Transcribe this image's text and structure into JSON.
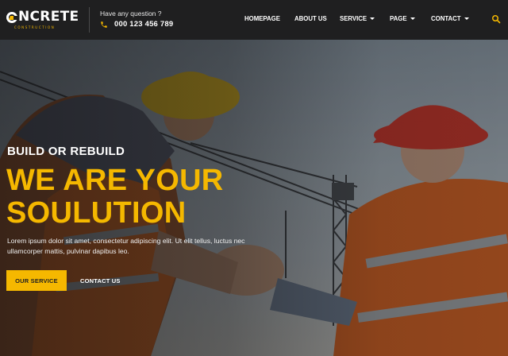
{
  "brand": {
    "logo_text": "NCRETE",
    "logo_sub": "CONSTRUCTION",
    "accent": "#f5b800"
  },
  "contact": {
    "question": "Have any question ?",
    "phone": "000 123 456 789",
    "icon": "phone-icon"
  },
  "nav": {
    "items": [
      {
        "label": "HOMEPAGE",
        "dropdown": false
      },
      {
        "label": "ABOUT US",
        "dropdown": false
      },
      {
        "label": "SERVICE",
        "dropdown": true
      },
      {
        "label": "PAGE",
        "dropdown": true
      },
      {
        "label": "CONTACT",
        "dropdown": true
      }
    ],
    "search_icon": "search-icon"
  },
  "hero": {
    "kicker": "BUILD OR REBUILD",
    "headline_line1": "WE ARE YOUR",
    "headline_line2": "SOULUTION",
    "description": "Lorem ipsum dolor sit amet, consectetur adipiscing elit. Ut elit tellus, luctus nec ullamcorper mattis, pulvinar dapibus leo.",
    "primary_button": "OUR SERVICE",
    "secondary_button": "CONTACT US",
    "background_image": "two construction workers in hard hats and orange safety vests shaking hands in front of a crane"
  }
}
